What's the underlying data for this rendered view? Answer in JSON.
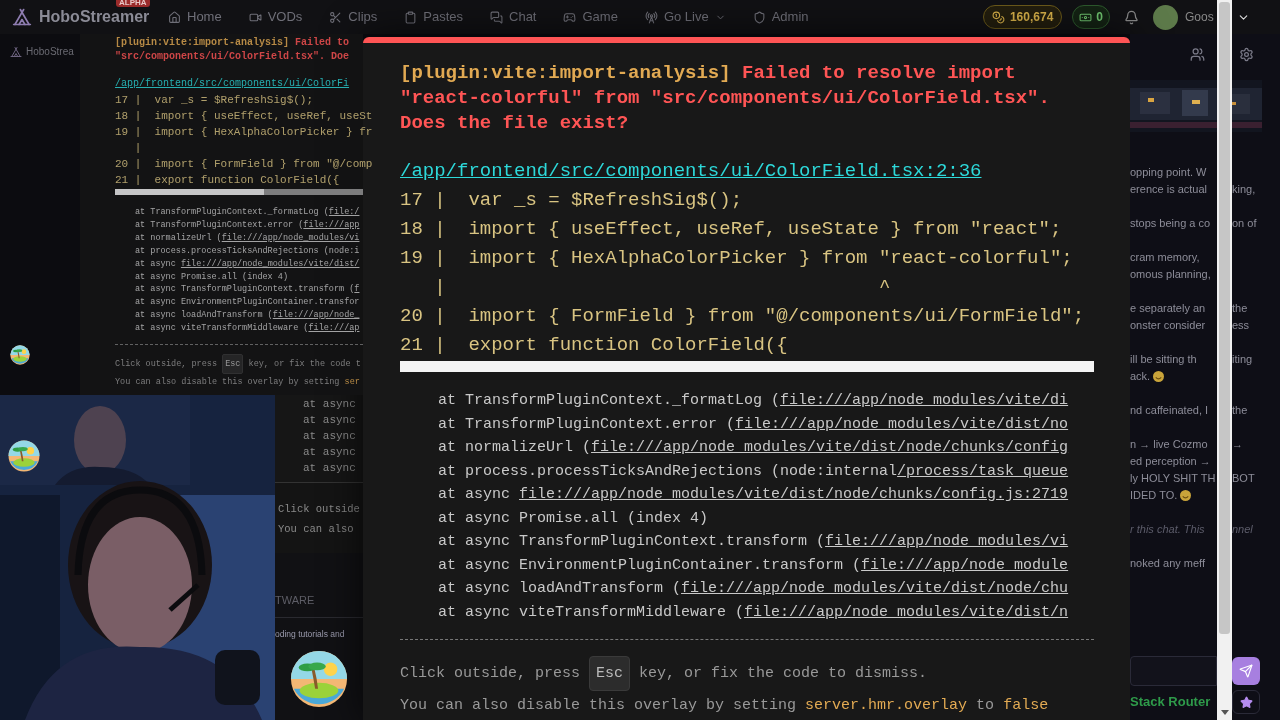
{
  "nav": {
    "logo": "HoboStreamer",
    "badge": "ALPHA",
    "items": [
      {
        "label": "Home",
        "dropdown": false
      },
      {
        "label": "VODs",
        "dropdown": false
      },
      {
        "label": "Clips",
        "dropdown": false
      },
      {
        "label": "Pastes",
        "dropdown": false
      },
      {
        "label": "Chat",
        "dropdown": false
      },
      {
        "label": "Game",
        "dropdown": false
      },
      {
        "label": "Go Live",
        "dropdown": true
      },
      {
        "label": "Admin",
        "dropdown": false
      }
    ],
    "coins": "160,674",
    "cash": "0",
    "user": "Goos"
  },
  "sidebar_label": "HoboStrea",
  "mini_overlay": {
    "title_lines": [
      [
        {
          "kind": "plugin",
          "text": "[plugin:vite:import-analysis]"
        },
        {
          "kind": "message",
          "text": " Failed to"
        }
      ],
      [
        {
          "kind": "message",
          "text": "\"src/components/ui/ColorField.tsx\". Doe"
        }
      ]
    ],
    "file": "/app/frontend/src/components/ui/ColorFi",
    "code": [
      "17 |  var _s = $RefreshSig$();",
      "18 |  import { useEffect, useRef, useSt",
      "19 |  import { HexAlphaColorPicker } fr",
      "   |",
      "20 |  import { FormField } from \"@/comp",
      "21 |  export function ColorField({"
    ],
    "stack": [
      {
        "text": "at TransformPluginContext._formatLog (",
        "link": "file:/"
      },
      {
        "text": "at TransformPluginContext.error (",
        "link": "file:///app"
      },
      {
        "text": "at normalizeUrl (",
        "link": "file:///app/node_modules/vi"
      },
      {
        "text": "at process.processTicksAndRejections (node:i"
      },
      {
        "text": "at async ",
        "link": "file:///app/node_modules/vite/dist/"
      },
      {
        "text": "at async Promise.all (index 4)"
      },
      {
        "text": "at async TransformPluginContext.transform (",
        "link": "f"
      },
      {
        "text": "at async EnvironmentPluginContainer.transfor"
      },
      {
        "text": "at async loadAndTransform (",
        "link": "file:///app/node_"
      },
      {
        "text": "at async viteTransformMiddleware (",
        "link": "file:///ap"
      }
    ],
    "hint": {
      "before": "Click outside, press ",
      "key": "Esc",
      "after": " key, or fix the code t"
    },
    "tip": [
      {
        "text": "You can also disable this overlay by setting ",
        "code": false
      },
      {
        "text": "ser",
        "code": true
      }
    ]
  },
  "overlay": {
    "title_lines": [
      [
        {
          "kind": "plugin",
          "text": "[plugin:vite:import-analysis]"
        },
        {
          "kind": "message",
          "text": " Failed to resolve import"
        }
      ],
      [
        {
          "kind": "message",
          "text": "\"react-colorful\" from \"src/components/ui/ColorField.tsx\"."
        }
      ],
      [
        {
          "kind": "message",
          "text": "Does the file exist?"
        }
      ]
    ],
    "file": "/app/frontend/src/components/ui/ColorField.tsx:2:36",
    "code": [
      "17 |  var _s = $RefreshSig$();",
      "18 |  import { useEffect, useRef, useState } from \"react\";",
      "19 |  import { HexAlphaColorPicker } from \"react-colorful\";",
      "   |                                      ^",
      "20 |  import { FormField } from \"@/components/ui/FormField\";",
      "21 |  export function ColorField({"
    ],
    "stack": [
      {
        "text": "at TransformPluginContext._formatLog (",
        "link": "file:///app/node_modules/vite/di"
      },
      {
        "text": "at TransformPluginContext.error (",
        "link": "file:///app/node_modules/vite/dist/no"
      },
      {
        "text": "at normalizeUrl (",
        "link": "file:///app/node_modules/vite/dist/node/chunks/config"
      },
      {
        "text": "at process.processTicksAndRejections (node:internal",
        "link": "/process/task_queue"
      },
      {
        "text": "at async ",
        "link": "file:///app/node_modules/vite/dist/node/chunks/config.js:2719"
      },
      {
        "text": "at async Promise.all (index 4)"
      },
      {
        "text": "at async TransformPluginContext.transform (",
        "link": "file:///app/node_modules/vi"
      },
      {
        "text": "at async EnvironmentPluginContainer.transform (",
        "link": "file:///app/node_module"
      },
      {
        "text": "at async loadAndTransform (",
        "link": "file:///app/node_modules/vite/dist/node/chu"
      },
      {
        "text": "at async viteTransformMiddleware (",
        "link": "file:///app/node_modules/vite/dist/n"
      }
    ],
    "hint": {
      "before": "Click outside, press ",
      "key": "Esc",
      "after": " key, or fix the code to dismiss."
    },
    "tip": [
      {
        "text": "You can also disable this overlay by setting ",
        "code": false
      },
      {
        "text": "server.hmr.overlay",
        "code": true
      },
      {
        "text": " to ",
        "code": false
      },
      {
        "text": "false",
        "code": true
      }
    ]
  },
  "side_fragments": {
    "stack": [
      "at async",
      "at async",
      "at async",
      "at async",
      "at async"
    ],
    "footer": [
      "Click outside",
      "You can also"
    ],
    "heading": "TWARE",
    "text": "oding tutorials and"
  },
  "chat": {
    "messages": [
      {
        "kind": "message",
        "lines": [
          {
            "left": "opping point. W"
          },
          {
            "left": "erence is actual",
            "right": "king,"
          }
        ]
      },
      {
        "kind": "message",
        "lines": [
          {
            "left": "stops being a co",
            "right": "on of"
          }
        ]
      },
      {
        "kind": "message",
        "lines": [
          {
            "left": "cram memory,"
          },
          {
            "left": "omous planning,"
          }
        ]
      },
      {
        "kind": "message",
        "lines": [
          {
            "left": "e separately an",
            "right": "the"
          },
          {
            "left": "onster consider",
            "right": "ess"
          }
        ]
      },
      {
        "kind": "message",
        "lines": [
          {
            "left": "ill be sitting th",
            "right": "iting"
          },
          {
            "left": "ack.",
            "emoji": true
          }
        ]
      },
      {
        "kind": "message",
        "lines": [
          {
            "left": "nd caffeinated, I",
            "right": "the"
          }
        ]
      },
      {
        "kind": "message",
        "lines": [
          {
            "left": "n → live Cozmo",
            "right": "→"
          },
          {
            "left": "ed perception →"
          },
          {
            "left": "ly HOLY SHIT TH",
            "right": "BOT"
          },
          {
            "left": "IDED TO.",
            "emoji": true
          }
        ]
      },
      {
        "kind": "notice",
        "lines": [
          {
            "left": "r this chat. This",
            "right": "nnel"
          }
        ]
      },
      {
        "kind": "message",
        "lines": [
          {
            "left": "noked any meff"
          }
        ]
      }
    ],
    "tag": "Stack Router"
  }
}
